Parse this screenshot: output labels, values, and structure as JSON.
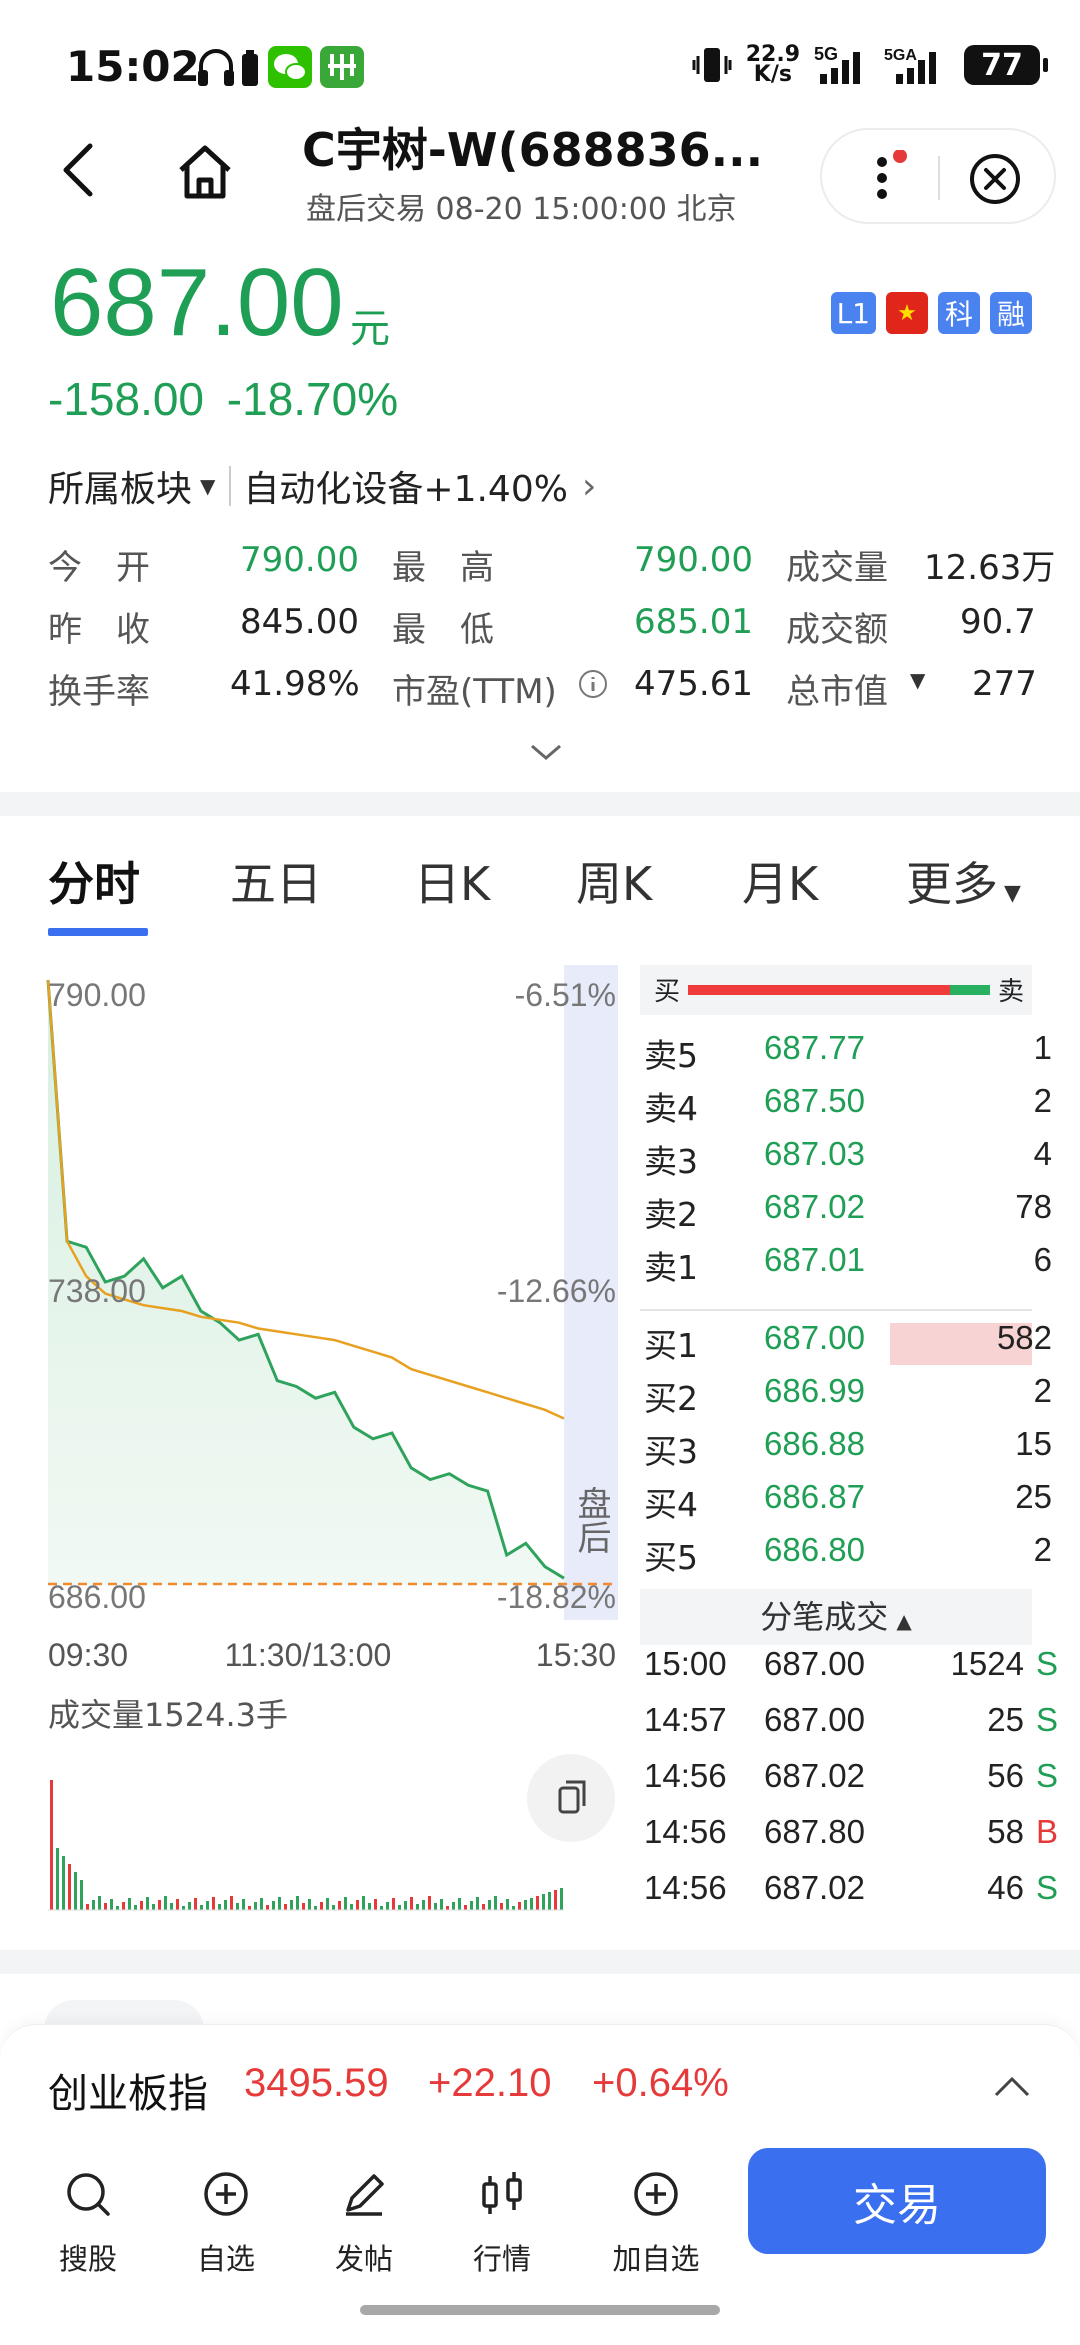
{
  "status_bar": {
    "time": "15:02",
    "net_speed_value": "22.9",
    "net_speed_unit": "K/s",
    "signal1": "5G",
    "signal2": "5GA",
    "battery": "77",
    "icons": [
      "headphones-icon",
      "battery-small-icon",
      "wechat-icon",
      "app-notify-icon",
      "bluetooth-icon",
      "vibrate-icon",
      "signal-icon"
    ]
  },
  "header": {
    "title": "C宇树-W(688836...",
    "subtitle": "盘后交易 08-20 15:00:00 北京"
  },
  "quote": {
    "price": "687.00",
    "unit": "元",
    "change": "-158.00",
    "change_pct": "-18.70%",
    "badges": [
      "L1",
      "科",
      "融"
    ],
    "sector_label": "所属板块",
    "sector_name": "自动化设备+1.40%",
    "colors": {
      "down": "#1f9e55",
      "up": "#e63a3a",
      "accent": "#3a6ff0"
    }
  },
  "stats": {
    "open_label": "今　开",
    "open": "790.00",
    "high_label": "最　高",
    "high": "790.00",
    "vol_label": "成交量",
    "vol": "12.63万",
    "prev_label": "昨　收",
    "prev": "845.00",
    "low_label": "最　低",
    "low": "685.01",
    "amount_label": "成交额",
    "amount": "90.7",
    "turnover_label": "换手率",
    "turnover": "41.98%",
    "pe_label": "市盈(TTM)",
    "pe": "475.61",
    "mcap_label": "总市值",
    "mcap": "277"
  },
  "tabs": [
    "分时",
    "五日",
    "日K",
    "周K",
    "月K",
    "更多"
  ],
  "chart": {
    "y_top": "790.00",
    "y_mid": "738.00",
    "y_bot": "686.00",
    "pct_top": "-6.51%",
    "pct_mid": "-12.66%",
    "pct_bot": "-18.82%",
    "x_start": "09:30",
    "x_mid": "11:30/13:00",
    "x_end": "15:30",
    "after_hours": "盘后",
    "volume_label": "成交量1524.3手"
  },
  "chart_data": {
    "type": "line",
    "title": "",
    "x": [
      "09:30",
      "11:30/13:00",
      "15:30"
    ],
    "ylim": [
      686.0,
      790.0
    ],
    "series": [
      {
        "values": [
          790.0,
          745.0,
          744.0,
          738.0,
          739.0,
          742.0,
          737.0,
          739.0,
          733.0,
          731.0,
          728.0,
          729.0,
          721.0,
          720.0,
          718.0,
          719.0,
          713.0,
          711.0,
          712.0,
          706.0,
          704.0,
          705.0,
          703.0,
          702.0,
          691.0,
          693.0,
          689.0,
          687.0
        ]
      },
      {
        "values": [
          790.0,
          745.0,
          739.0,
          736.0,
          735.0,
          734.0,
          733.5,
          733.0,
          732.0,
          731.5,
          731.0,
          730.0,
          729.5,
          729.0,
          728.5,
          728.0,
          727.0,
          726.0,
          725.0,
          723.0,
          722.0,
          721.0,
          720.0,
          719.0,
          718.0,
          717.0,
          716.0,
          714.5
        ]
      }
    ]
  },
  "order_book": {
    "ratio_buy": "买",
    "ratio_sell": "卖",
    "ratio_value": 0.87,
    "asks": [
      {
        "label": "卖5",
        "price": "687.77",
        "vol": "1"
      },
      {
        "label": "卖4",
        "price": "687.50",
        "vol": "2"
      },
      {
        "label": "卖3",
        "price": "687.03",
        "vol": "4"
      },
      {
        "label": "卖2",
        "price": "687.02",
        "vol": "78"
      },
      {
        "label": "卖1",
        "price": "687.01",
        "vol": "6"
      }
    ],
    "bids": [
      {
        "label": "买1",
        "price": "687.00",
        "vol": "582"
      },
      {
        "label": "买2",
        "price": "686.99",
        "vol": "2"
      },
      {
        "label": "买3",
        "price": "686.88",
        "vol": "15"
      },
      {
        "label": "买4",
        "price": "686.87",
        "vol": "25"
      },
      {
        "label": "买5",
        "price": "686.80",
        "vol": "2"
      }
    ],
    "ticks_header": "分笔成交",
    "ticks": [
      {
        "time": "15:00",
        "price": "687.00",
        "vol": "1524",
        "side": "S"
      },
      {
        "time": "14:57",
        "price": "687.00",
        "vol": "25",
        "side": "S"
      },
      {
        "time": "14:56",
        "price": "687.02",
        "vol": "56",
        "side": "S"
      },
      {
        "time": "14:56",
        "price": "687.80",
        "vol": "58",
        "side": "B"
      },
      {
        "time": "14:56",
        "price": "687.02",
        "vol": "46",
        "side": "S"
      }
    ]
  },
  "index_bar": {
    "name": "创业板指",
    "value": "3495.59",
    "change": "+22.10",
    "pct": "+0.64%"
  },
  "bottom_nav": {
    "items": [
      "搜股",
      "自选",
      "发帖",
      "行情",
      "加自选"
    ],
    "trade": "交易"
  }
}
